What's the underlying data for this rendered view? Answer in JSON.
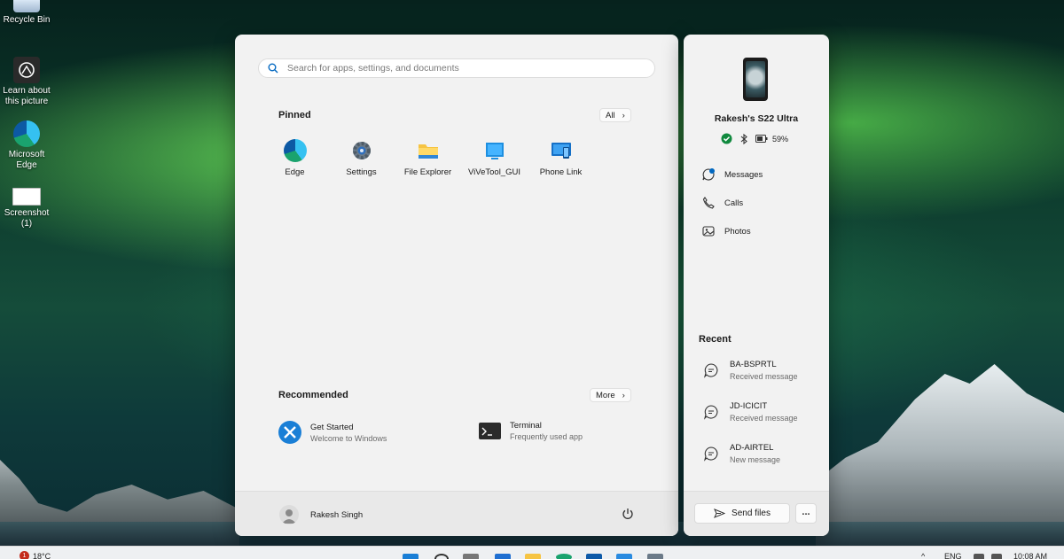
{
  "desktop": {
    "icons": [
      {
        "label": "Recycle Bin"
      },
      {
        "label": "Learn about this picture"
      },
      {
        "label": "Microsoft Edge"
      },
      {
        "label": "Screenshot (1)"
      }
    ]
  },
  "start_menu": {
    "search_placeholder": "Search for apps, settings, and documents",
    "pinned": {
      "title": "Pinned",
      "all_button": "All",
      "apps": [
        {
          "label": "Edge",
          "icon": "edge-icon"
        },
        {
          "label": "Settings",
          "icon": "gear-icon"
        },
        {
          "label": "File Explorer",
          "icon": "folder-icon"
        },
        {
          "label": "ViVeTool_GUI",
          "icon": "vivetool-icon"
        },
        {
          "label": "Phone Link",
          "icon": "phone-link-icon"
        }
      ]
    },
    "recommended": {
      "title": "Recommended",
      "more_button": "More",
      "items": [
        {
          "title": "Get Started",
          "subtitle": "Welcome to Windows",
          "icon": "get-started-icon"
        },
        {
          "title": "Terminal",
          "subtitle": "Frequently used app",
          "icon": "terminal-icon"
        }
      ]
    },
    "user": {
      "name": "Rakesh Singh"
    }
  },
  "phone_panel": {
    "device_name": "Rakesh's S22 Ultra",
    "battery": "59%",
    "actions": [
      {
        "label": "Messages",
        "icon": "messages-icon"
      },
      {
        "label": "Calls",
        "icon": "phone-icon"
      },
      {
        "label": "Photos",
        "icon": "photos-icon"
      }
    ],
    "recent_title": "Recent",
    "recent": [
      {
        "title": "BA-BSPRTL",
        "subtitle": "Received message"
      },
      {
        "title": "JD-ICICIT",
        "subtitle": "Received message"
      },
      {
        "title": "AD-AIRTEL",
        "subtitle": "New message"
      }
    ],
    "send_files": "Send files",
    "more": "..."
  },
  "taskbar": {
    "weather_badge": "1",
    "temperature": "18°C",
    "language": "ENG",
    "time": "10:08 AM"
  },
  "colors": {
    "accent": "#0067c0",
    "panel_bg": "#f2f2f2",
    "online_green": "#10893e"
  }
}
